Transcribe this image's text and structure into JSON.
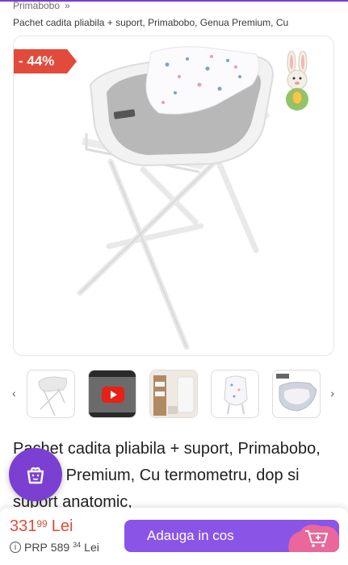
{
  "breadcrumb": {
    "label": "Primabobo",
    "separator": "»"
  },
  "header": {
    "title": "Pachet cadita pliabila + suport, Primabobo, Genua Premium, Cu"
  },
  "gallery": {
    "discount_badge": "- 44%"
  },
  "thumbnails": {
    "prev_arrow": "‹",
    "next_arrow": "›",
    "items": [
      "tub-on-stand-thumbnail",
      "video-thumbnail",
      "lifestyle-thumbnail",
      "seat-thumbnail",
      "folded-tub-thumbnail"
    ]
  },
  "product": {
    "title": "Pachet cadita pliabila + suport, Primabobo, Genua Premium, Cu termometru, dop si suport anatomic,"
  },
  "pricing": {
    "price_int": "331",
    "price_dec": "99",
    "currency": "Lei",
    "prp_label": "PRP",
    "prp_int": "589",
    "prp_dec": "34",
    "prp_currency": "Lei"
  },
  "actions": {
    "add_to_cart": "Adauga in cos"
  },
  "colors": {
    "accent": "#8a54e6",
    "fab": "#7b3fd1",
    "discount": "#e24a3b",
    "price": "#e24a3b"
  }
}
